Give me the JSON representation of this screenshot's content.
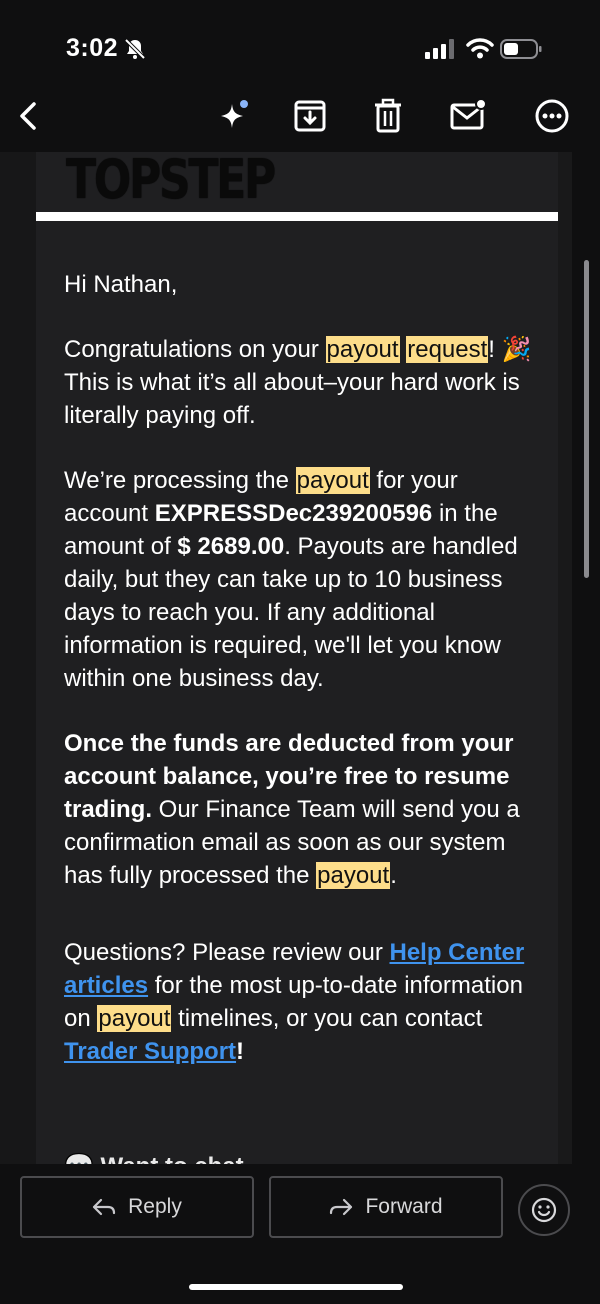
{
  "status_bar": {
    "time": "3:02"
  },
  "email": {
    "brand": "TOPSTEP",
    "greeting": "Hi Nathan,",
    "p1": {
      "text1": "Congratulations on your ",
      "hl1": "payout",
      "hl2": "request",
      "text2": "! 🎉 This is what it’s all about–your hard work is literally paying off."
    },
    "p2": {
      "text1": "We’re processing the ",
      "hl1": "payout",
      "text2": " for your account ",
      "account": "EXPRESSDec239200596",
      "text3": " in the amount of ",
      "amount": "$ 2689.00",
      "text4": ". Payouts are handled daily, but they can take up to 10 business days to reach you. If any additional information is required, we'll let you know within one business day."
    },
    "p3": {
      "bold": "Once the funds are deducted from your account balance, you’re free to resume trading.",
      "text1": " Our Finance Team will send you a confirmation email as soon as our system has fully processed the ",
      "hl1": "payout",
      "text2": "."
    },
    "p4": {
      "text1": "Questions? Please review our ",
      "link1": "Help Center articles",
      "text2": " for the most up-to-date information on ",
      "hl1": "payout",
      "text3": " timelines, or you can contact ",
      "link2": "Trader Support",
      "text4": "!"
    },
    "partial_next": "💬  Want to chat"
  },
  "actions": {
    "reply_label": "Reply",
    "forward_label": "Forward"
  },
  "colors": {
    "highlight": "#fddd8a",
    "link": "#3f93ee",
    "background": "#0f0f10",
    "card": "#1f1f21"
  }
}
